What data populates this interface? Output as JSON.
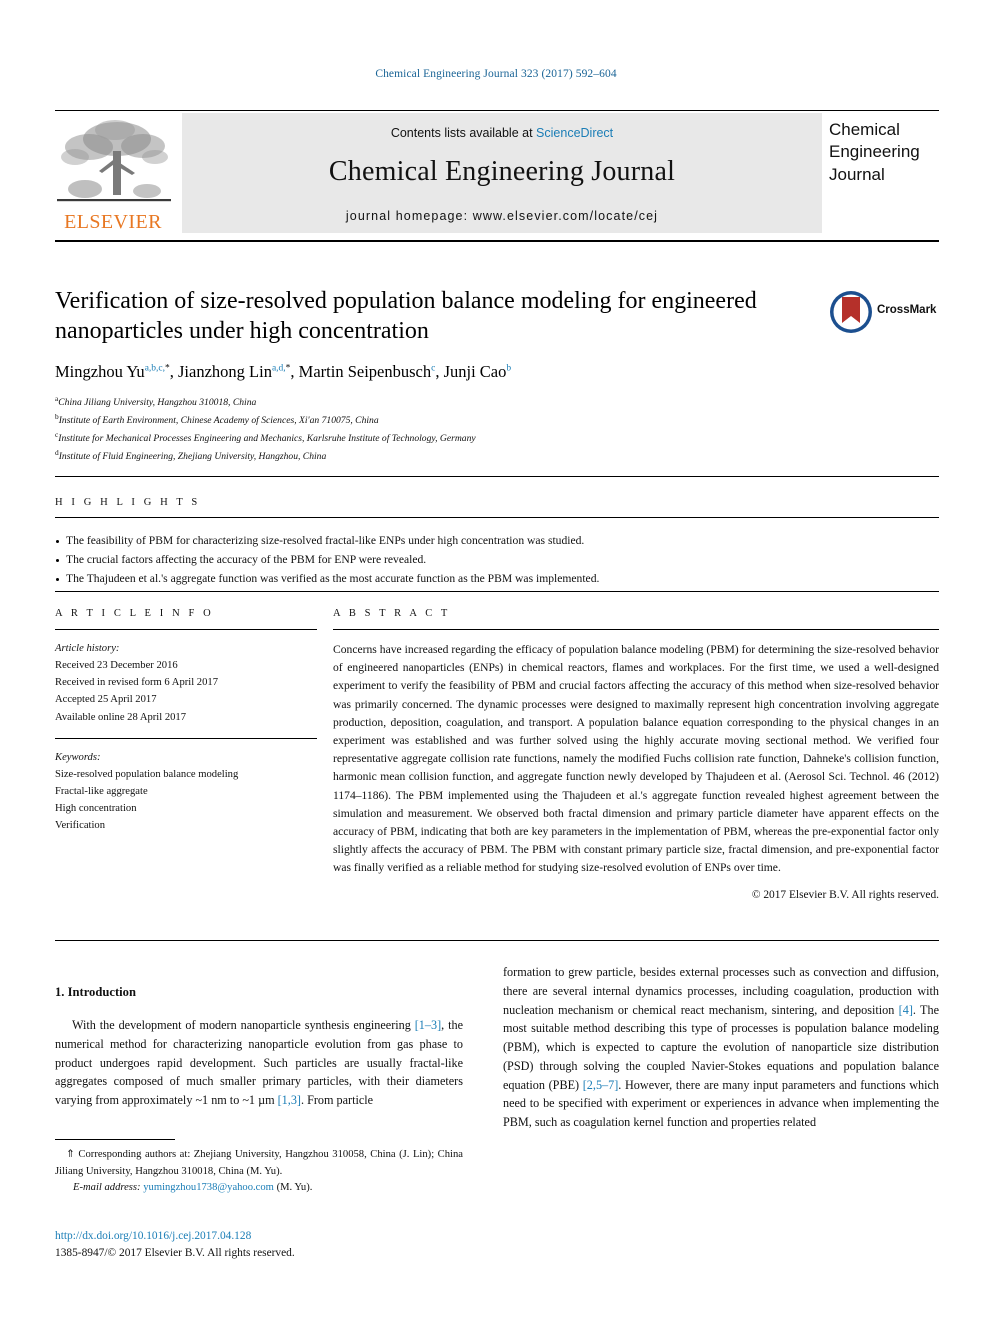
{
  "running_head": "Chemical Engineering Journal 323 (2017) 592–604",
  "masthead": {
    "contents_prefix": "Contents lists available at",
    "sciencedirect": "ScienceDirect",
    "journal_title": "Chemical Engineering Journal",
    "homepage": "journal homepage: www.elsevier.com/locate/cej",
    "publisher": "ELSEVIER",
    "cover_lines": [
      "Chemical",
      "Engineering",
      "Journal"
    ]
  },
  "article": {
    "title": "Verification of size-resolved population balance modeling for engineered nanoparticles under high concentration",
    "crossmark_label": "CrossMark",
    "authors": [
      {
        "name": "Mingzhou Yu",
        "sup": "a,b,c,",
        "star": "*",
        "sep": ", "
      },
      {
        "name": "Jianzhong Lin",
        "sup": "a,d,",
        "star": "*",
        "sep": ", "
      },
      {
        "name": "Martin Seipenbusch",
        "sup": "c",
        "star": "",
        "sep": ", "
      },
      {
        "name": "Junji Cao",
        "sup": "b",
        "star": "",
        "sep": ""
      }
    ],
    "affiliations": [
      {
        "mark": "a",
        "text": "China Jiliang University, Hangzhou 310018, China"
      },
      {
        "mark": "b",
        "text": "Institute of Earth Environment, Chinese Academy of Sciences, Xi'an 710075, China"
      },
      {
        "mark": "c",
        "text": "Institute for Mechanical Processes Engineering and Mechanics, Karlsruhe Institute of Technology, Germany"
      },
      {
        "mark": "d",
        "text": "Institute of Fluid Engineering, Zhejiang University, Hangzhou, China"
      }
    ]
  },
  "highlights": {
    "heading": "H I G H L I G H T S",
    "items": [
      "The feasibility of PBM for characterizing size-resolved fractal-like ENPs under high concentration was studied.",
      "The crucial factors affecting the accuracy of the PBM for ENP were revealed.",
      "The Thajudeen et al.'s aggregate function was verified as the most accurate function as the PBM was implemented."
    ]
  },
  "article_info": {
    "heading": "A R T I C L E    I N F O",
    "history_label": "Article history:",
    "history": [
      "Received 23 December 2016",
      "Received in revised form 6 April 2017",
      "Accepted 25 April 2017",
      "Available online 28 April 2017"
    ],
    "keywords_label": "Keywords:",
    "keywords": [
      "Size-resolved population balance modeling",
      "Fractal-like aggregate",
      "High concentration",
      "Verification"
    ]
  },
  "abstract": {
    "heading": "A B S T R A C T",
    "text": "Concerns have increased regarding the efficacy of population balance modeling (PBM) for determining the size-resolved behavior of engineered nanoparticles (ENPs) in chemical reactors, flames and workplaces. For the first time, we used a well-designed experiment to verify the feasibility of PBM and crucial factors affecting the accuracy of this method when size-resolved behavior was primarily concerned. The dynamic processes were designed to maximally represent high concentration involving aggregate production, deposition, coagulation, and transport. A population balance equation corresponding to the physical changes in an experiment was established and was further solved using the highly accurate moving sectional method. We verified four representative aggregate collision rate functions, namely the modified Fuchs collision rate function, Dahneke's collision function, harmonic mean collision function, and aggregate function newly developed by Thajudeen et al. (Aerosol Sci. Technol. 46 (2012) 1174–1186). The PBM implemented using the Thajudeen et al.'s aggregate function revealed highest agreement between the simulation and measurement. We observed both fractal dimension and primary particle diameter have apparent effects on the accuracy of PBM, indicating that both are key parameters in the implementation of PBM, whereas the pre-exponential factor only slightly affects the accuracy of PBM. The PBM with constant primary particle size, fractal dimension, and pre-exponential factor was finally verified as a reliable method for studying size-resolved evolution of ENPs over time.",
    "copyright": "© 2017 Elsevier B.V. All rights reserved."
  },
  "body": {
    "section_heading": "1. Introduction",
    "left_paragraph_parts": [
      "With the development of modern nanoparticle synthesis engineering ",
      "[1–3]",
      ", the numerical method for characterizing nanoparticle evolution from gas phase to product undergoes rapid development. Such particles are usually fractal-like aggregates composed of much smaller primary particles, with their diameters varying from approximately ~1 nm to ~1 µm ",
      "[1,3]",
      ". From particle"
    ],
    "right_paragraph_parts": [
      "formation to grew particle, besides external processes such as convection and diffusion, there are several internal dynamics processes, including coagulation, production with nucleation mechanism or chemical react mechanism, sintering, and deposition ",
      "[4]",
      ". The most suitable method describing this type of processes is population balance modeling (PBM), which is expected to capture the evolution of nanoparticle size distribution (PSD) through solving the coupled Navier-Stokes equations and population balance equation (PBE) ",
      "[2,5–7]",
      ". However, there are many input parameters and functions which need to be specified with experiment or experiences in advance when implementing the PBM, such as coagulation kernel function and properties related"
    ]
  },
  "footnote": {
    "star": "⇑",
    "text": " Corresponding authors at: Zhejiang University, Hangzhou 310058, China (J. Lin); China Jiliang University, Hangzhou 310018, China (M. Yu).",
    "email_label": "E-mail address:",
    "email": "yumingzhou1738@yahoo.com",
    "email_suffix": "(M. Yu)."
  },
  "footer": {
    "doi": "http://dx.doi.org/10.1016/j.cej.2017.04.128",
    "issn_line": "1385-8947/© 2017 Elsevier B.V. All rights reserved."
  },
  "colors": {
    "link": "#1a7db6",
    "elsevier_orange": "#E87722",
    "masthead_bg": "#e8e8e8",
    "crossmark_red": "#b5302a",
    "crossmark_blue": "#1c4f8f"
  }
}
